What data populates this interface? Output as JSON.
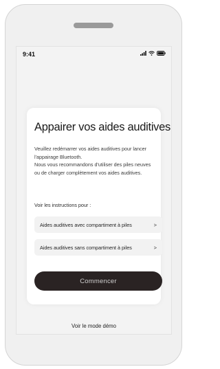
{
  "status_bar": {
    "time": "9:41",
    "icons": [
      "signal-icon",
      "wifi-icon",
      "battery-icon"
    ]
  },
  "card": {
    "title": "Appairer vos aides auditives",
    "body_line_1": "Veuillez redémarrer vos aides auditives pour lancer l'appairage Bluetooth.",
    "body_line_2": "Nous vous recommandons d'utiliser des piles neuves ou de charger complètement vos aides auditives.",
    "instructions_label": "Voir les instructions pour :",
    "options": [
      {
        "label": "Aides auditives avec compartiment à piles",
        "chevron": ">"
      },
      {
        "label": "Aides auditives sans compartiment à piles",
        "chevron": ">"
      }
    ],
    "start_button": "Commencer"
  },
  "demo_link": "Voir le mode démo",
  "colors": {
    "button_bg": "#2a2323",
    "screen_bg": "#f3f3f3",
    "option_bg": "#f2f2f2"
  }
}
